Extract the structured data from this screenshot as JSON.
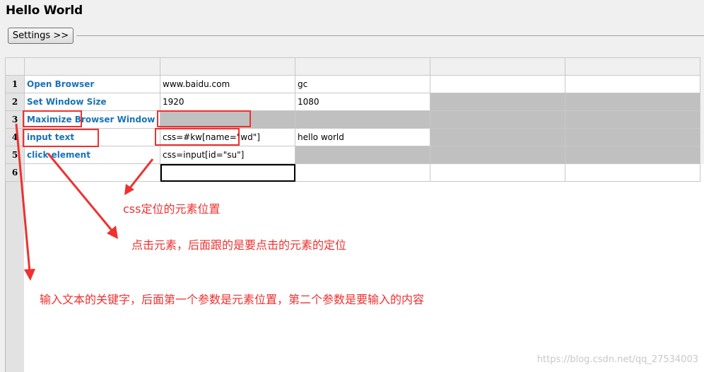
{
  "window": {
    "title": "Hello World"
  },
  "toolbar": {
    "settings_label": "Settings >>"
  },
  "rows": [
    {
      "num": "1",
      "keyword": "Open Browser",
      "arg1": "www.baidu.com",
      "arg2": "gc",
      "arg3": "",
      "arg4": ""
    },
    {
      "num": "2",
      "keyword": "Set Window Size",
      "arg1": "1920",
      "arg2": "1080",
      "arg3": "",
      "arg4": ""
    },
    {
      "num": "3",
      "keyword": "Maximize Browser Window",
      "arg1": "",
      "arg2": "",
      "arg3": "",
      "arg4": ""
    },
    {
      "num": "4",
      "keyword": "input text",
      "arg1": "css=#kw[name=\"wd\"]",
      "arg2": "hello world",
      "arg3": "",
      "arg4": ""
    },
    {
      "num": "5",
      "keyword": "click element",
      "arg1": "css=input[id=\"su\"]",
      "arg2": "",
      "arg3": "",
      "arg4": ""
    },
    {
      "num": "6",
      "keyword": "",
      "arg1": "",
      "arg2": "",
      "arg3": "",
      "arg4": ""
    }
  ],
  "annotations": {
    "css_locator": "css定位的元素位置",
    "click_note": "点击元素，后面跟的是要点击的元素的定位",
    "input_note": "输入文本的关键字，后面第一个参数是元素位置，第二个参数是要输入的内容"
  },
  "watermark": "https://blog.csdn.net/qq_27534003",
  "colors": {
    "keyword": "#1a72b8",
    "annotation": "#ef3030",
    "disabled_cell": "#c0c0c0"
  }
}
